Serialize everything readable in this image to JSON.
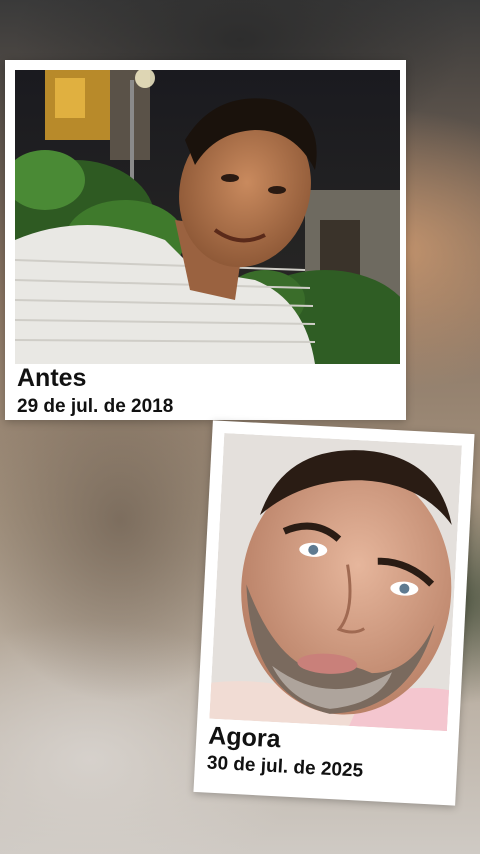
{
  "cards": [
    {
      "title": "Antes",
      "date": "29 de jul. de 2018"
    },
    {
      "title": "Agora",
      "date": "30 de jul. de 2025"
    }
  ]
}
